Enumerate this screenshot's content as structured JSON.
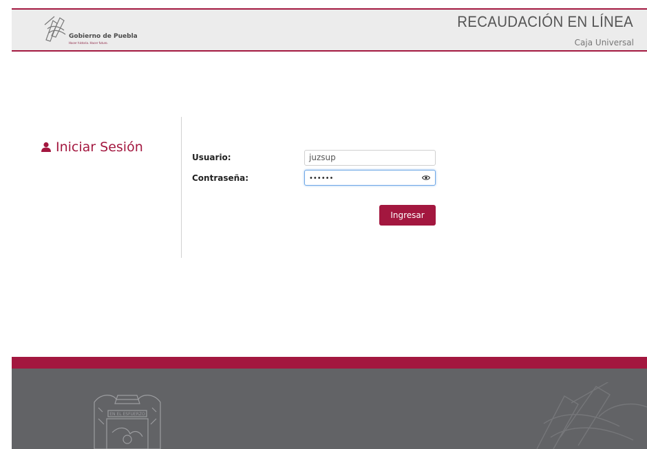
{
  "header": {
    "logo": {
      "name": "Gobierno de Puebla",
      "tagline": "Hacer historia. Hacer futuro."
    },
    "title": "RECAUDACIÓN EN LÍNEA",
    "subtitle": "Caja Universal"
  },
  "login": {
    "heading": "Iniciar Sesión",
    "user_label": "Usuario:",
    "user_value": "juzsup",
    "password_label": "Contraseña:",
    "password_mask": "••••••",
    "submit_label": "Ingresar"
  },
  "footer": {
    "crest_text": "EN EL ESFUERZO"
  },
  "colors": {
    "brand": "#a3173f",
    "footer_gray": "#626366",
    "header_gray": "#ececec"
  },
  "icons": [
    "user-icon",
    "eye-icon",
    "state-crest",
    "government-logo-mark"
  ]
}
